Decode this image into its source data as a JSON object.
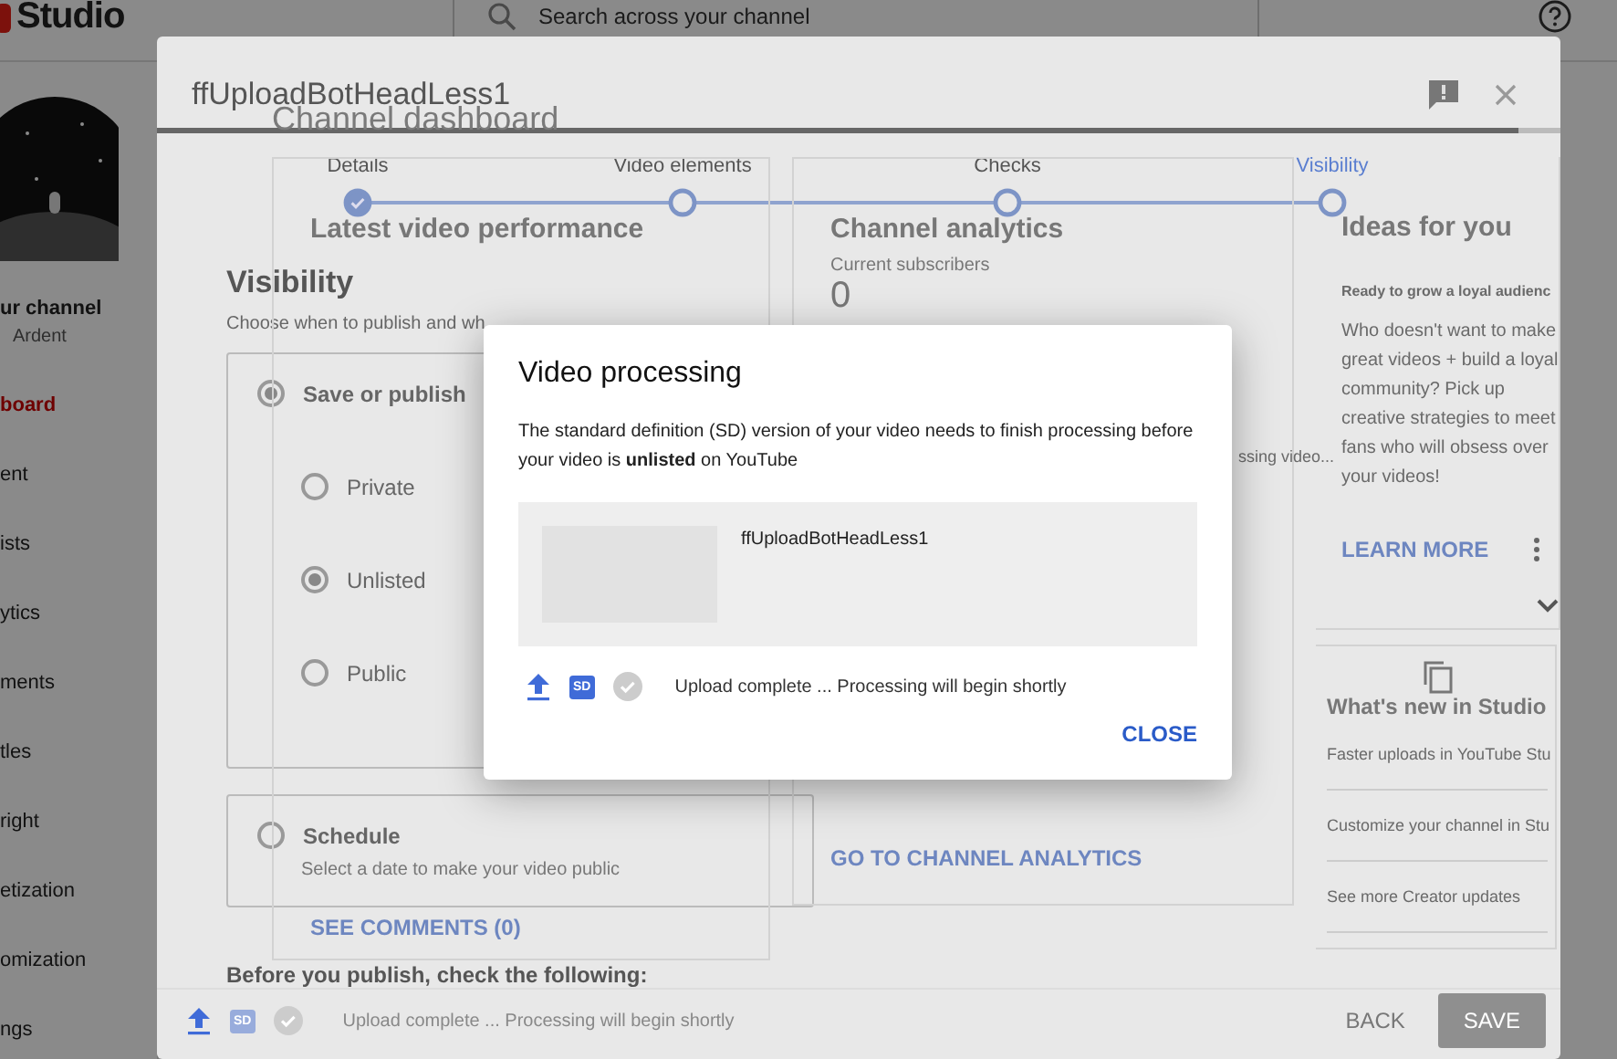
{
  "studio": {
    "logo": "Studio",
    "search_placeholder": "Search across your channel",
    "channel": {
      "name": "ur channel",
      "handle": "Ardent"
    },
    "nav": [
      {
        "label": "board",
        "selected": true
      },
      {
        "label": "ent",
        "selected": false
      },
      {
        "label": "ists",
        "selected": false
      },
      {
        "label": "ytics",
        "selected": false
      },
      {
        "label": "ments",
        "selected": false
      },
      {
        "label": "tles",
        "selected": false
      },
      {
        "label": "right",
        "selected": false
      },
      {
        "label": "etization",
        "selected": false
      },
      {
        "label": "omization",
        "selected": false
      },
      {
        "label": "ngs",
        "selected": false
      }
    ]
  },
  "dashboard": {
    "title": "Channel dashboard",
    "video_card": {
      "title": "Latest video performance",
      "link": "SEE COMMENTS (0)"
    },
    "analytics_card": {
      "title": "Channel analytics",
      "subscribers_label": "Current subscribers",
      "subscribers": "0",
      "processing": "ssing video...",
      "link": "GO TO CHANNEL ANALYTICS"
    },
    "ideas_card": {
      "title": "Ideas for you",
      "heading": "Ready to grow a loyal audienc",
      "body": "Who doesn't want to make great videos + build a loyal community? Pick up creative strategies to meet fans who will obsess over your videos!",
      "link": "LEARN MORE"
    },
    "news_card": {
      "title": "What's new in Studio",
      "items": [
        "Faster uploads in YouTube Stu",
        "Customize your channel in Stu",
        "See more Creator updates"
      ]
    }
  },
  "upload_dialog": {
    "title": "ffUploadBotHeadLess1",
    "steps": [
      {
        "label": "Details",
        "done": true,
        "selected": false
      },
      {
        "label": "Video elements",
        "done": false,
        "selected": false
      },
      {
        "label": "Checks",
        "done": false,
        "selected": false
      },
      {
        "label": "Visibility",
        "done": false,
        "selected": true
      }
    ],
    "section_title": "Visibility",
    "section_hint": "Choose when to publish and wh",
    "options": [
      {
        "label": "Save or publish",
        "checked": true,
        "suboptions": [
          {
            "label": "Private",
            "checked": false
          },
          {
            "label": "Unlisted",
            "checked": true
          },
          {
            "label": "Public",
            "checked": false
          }
        ]
      },
      {
        "label": "Schedule",
        "checked": false,
        "hint": "Select a date to make your video public"
      }
    ],
    "checklist_title": "Before you publish, check the following:",
    "sd_badge": "SD",
    "status": "Upload complete ... Processing will begin shortly",
    "buttons": [
      {
        "label": "BACK",
        "disabled": false
      },
      {
        "label": "SAVE",
        "disabled": true
      }
    ]
  },
  "processing_modal": {
    "title": "Video processing",
    "message": "The standard definition (SD) version of your video needs to finish processing before your video is **unlisted** on YouTube",
    "video_title": "ffUploadBotHeadLess1",
    "sd_badge": "SD",
    "status": "Upload complete ... Processing will begin shortly",
    "button": "CLOSE"
  }
}
